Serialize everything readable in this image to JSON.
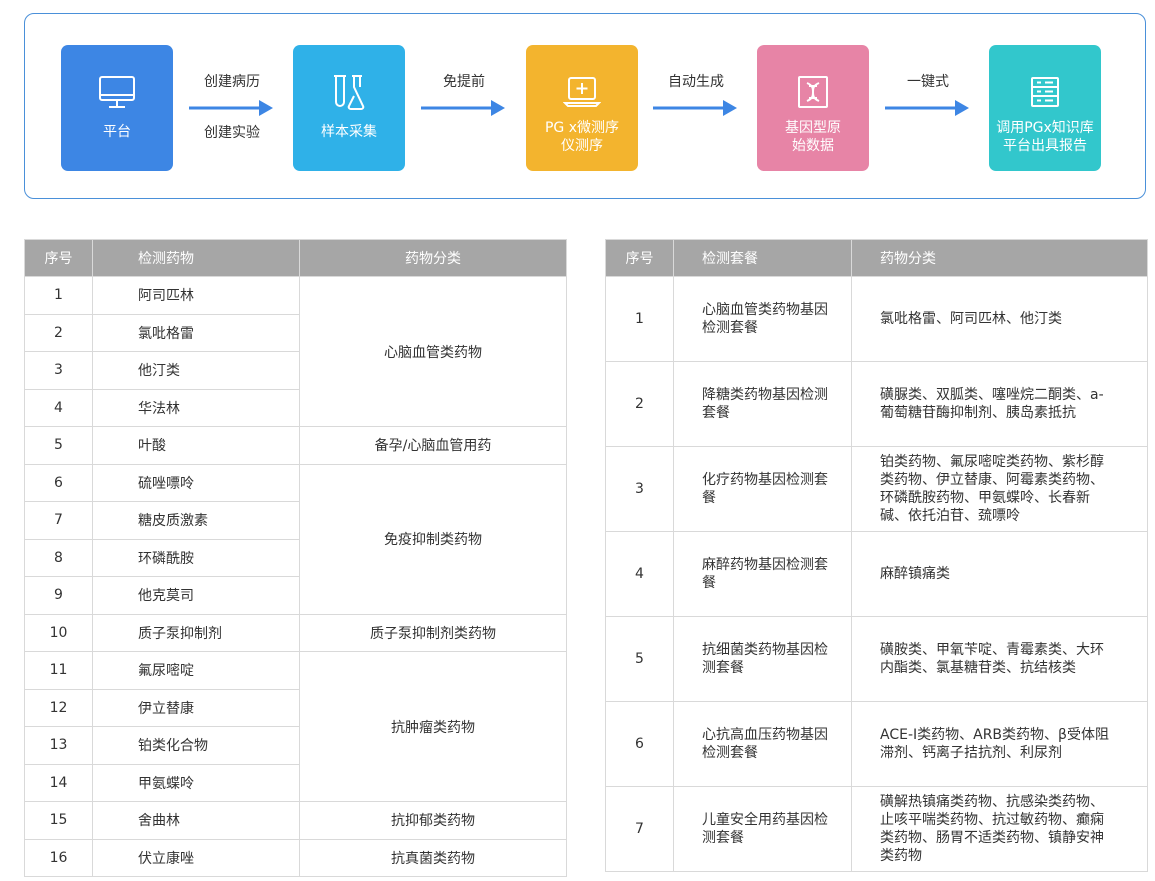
{
  "flow": {
    "steps": [
      {
        "label": "平台",
        "icon": "monitor-icon"
      },
      {
        "label": "样本采集",
        "icon": "test-tube-flask-icon"
      },
      {
        "label": "PG x微测序\n仪测序",
        "icon": "laptop-plus-icon"
      },
      {
        "label": "基因型原\n始数据",
        "icon": "dna-document-icon"
      },
      {
        "label": "调用PGx知识库\n平台出具报告",
        "icon": "server-list-icon"
      }
    ],
    "arrows": [
      {
        "top": "创建病历",
        "bottom": "创建实验"
      },
      {
        "top": "免提前",
        "bottom": ""
      },
      {
        "top": "自动生成",
        "bottom": ""
      },
      {
        "top": "一键式",
        "bottom": ""
      }
    ],
    "colors": {
      "border": "#4a90d9",
      "step1": "#3d86e4",
      "step2": "#2fb1e8",
      "step3": "#f3b42e",
      "step4": "#e784a6",
      "step5": "#32c7cc",
      "arrow": "#3d86e4"
    }
  },
  "drug_table": {
    "headers": [
      "序号",
      "检测药物",
      "药物分类"
    ],
    "rows": [
      {
        "no": "1",
        "drug": "阿司匹林"
      },
      {
        "no": "2",
        "drug": "氯吡格雷"
      },
      {
        "no": "3",
        "drug": "他汀类"
      },
      {
        "no": "4",
        "drug": "华法林"
      },
      {
        "no": "5",
        "drug": "叶酸"
      },
      {
        "no": "6",
        "drug": "硫唑嘌呤"
      },
      {
        "no": "7",
        "drug": "糖皮质激素"
      },
      {
        "no": "8",
        "drug": "环磷酰胺"
      },
      {
        "no": "9",
        "drug": "他克莫司"
      },
      {
        "no": "10",
        "drug": "质子泵抑制剂"
      },
      {
        "no": "11",
        "drug": "氟尿嘧啶"
      },
      {
        "no": "12",
        "drug": "伊立替康"
      },
      {
        "no": "13",
        "drug": "铂类化合物"
      },
      {
        "no": "14",
        "drug": "甲氨蝶呤"
      },
      {
        "no": "15",
        "drug": "舍曲林"
      },
      {
        "no": "16",
        "drug": "伏立康唑"
      }
    ],
    "categories": [
      {
        "label": "心脑血管类药物",
        "span": 4
      },
      {
        "label": "备孕/心脑血管用药",
        "span": 1
      },
      {
        "label": "免疫抑制类药物",
        "span": 4
      },
      {
        "label": "质子泵抑制剂类药物",
        "span": 1
      },
      {
        "label": "抗肿瘤类药物",
        "span": 4
      },
      {
        "label": "抗抑郁类药物",
        "span": 1
      },
      {
        "label": "抗真菌类药物",
        "span": 1
      }
    ]
  },
  "package_table": {
    "headers": [
      "序号",
      "检测套餐",
      "药物分类"
    ],
    "rows": [
      {
        "no": "1",
        "package": "心脑血管类药物基因检测套餐",
        "category": "氯吡格雷、阿司匹林、他汀类"
      },
      {
        "no": "2",
        "package": "降糖类药物基因检测套餐",
        "category": "磺脲类、双胍类、噻唑烷二酮类、a-葡萄糖苷酶抑制剂、胰岛素抵抗"
      },
      {
        "no": "3",
        "package": "化疗药物基因检测套餐",
        "category": "铂类药物、氟尿嘧啶类药物、紫杉醇类药物、伊立替康、阿霉素类药物、环磷酰胺药物、甲氨蝶呤、长春新碱、依托泊苷、巯嘌呤"
      },
      {
        "no": "4",
        "package": "麻醉药物基因检测套餐",
        "category": "麻醉镇痛类"
      },
      {
        "no": "5",
        "package": "抗细菌类药物基因检测套餐",
        "category": "磺胺类、甲氧苄啶、青霉素类、大环内酯类、氯基糖苷类、抗结核类"
      },
      {
        "no": "6",
        "package": "心抗高血压药物基因检测套餐",
        "category": "ACE-I类药物、ARB类药物、β受体阻滞剂、钙离子拮抗剂、利尿剂"
      },
      {
        "no": "7",
        "package": "儿童安全用药基因检测套餐",
        "category": "磺解热镇痛类药物、抗感染类药物、止咳平喘类药物、抗过敏药物、癫痫类药物、肠胃不适类药物、镇静安神类药物"
      }
    ]
  }
}
